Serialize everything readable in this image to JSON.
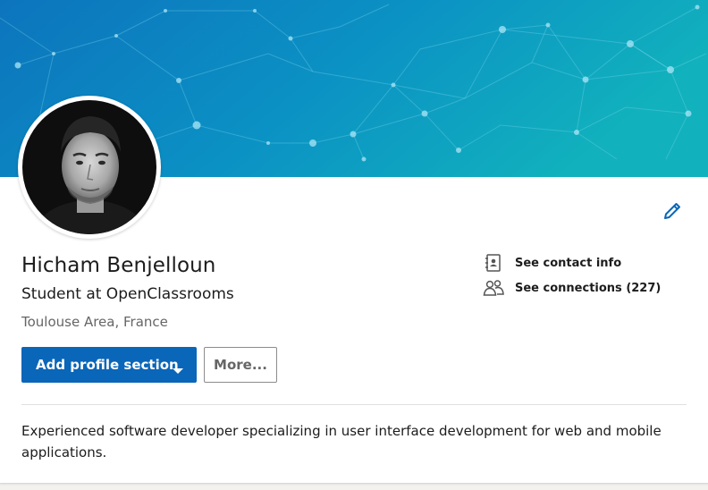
{
  "profile": {
    "name": "Hicham Benjelloun",
    "headline": "Student at OpenClassrooms",
    "location": "Toulouse Area, France",
    "summary": "Experienced software developer specializing in user interface development for web and mobile applications."
  },
  "contact": {
    "contact_info_label": "See contact info",
    "connections_label": "See connections (227)"
  },
  "actions": {
    "add_section_label": "Add profile section",
    "more_label": "More..."
  },
  "icons": {
    "edit": "pencil-icon",
    "contact": "address-book-icon",
    "connections": "people-icon",
    "dropdown": "caret-down-icon"
  },
  "colors": {
    "primary": "#0a66b8",
    "edit_icon": "#0a66b8",
    "banner_start": "#0c74bd",
    "banner_end": "#10aebd"
  }
}
